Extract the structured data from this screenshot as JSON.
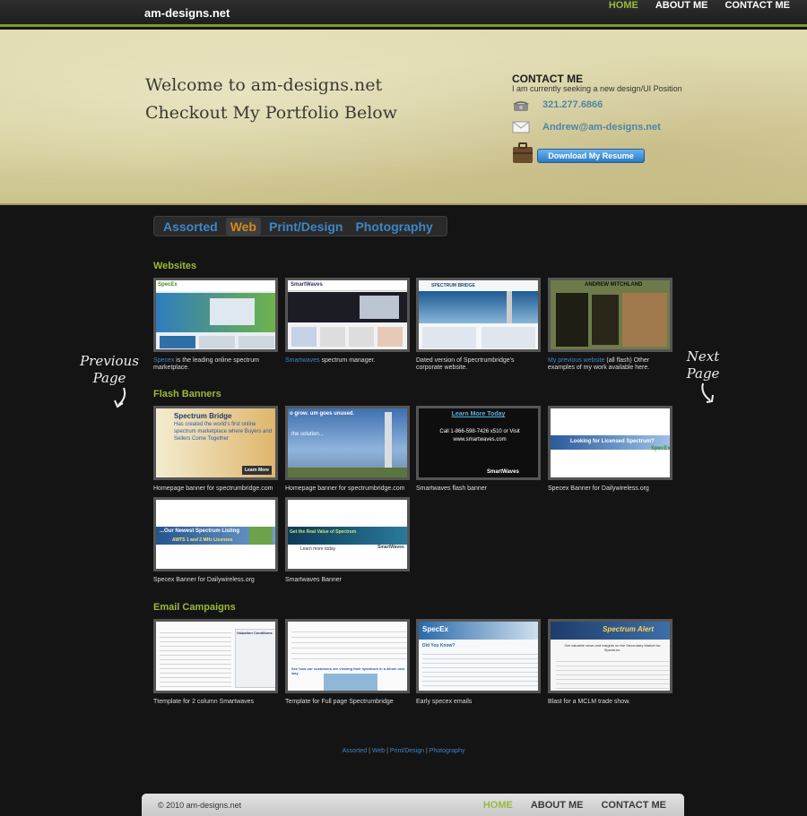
{
  "brand": {
    "logo": "am-designs.net"
  },
  "nav": {
    "items": [
      {
        "label": "HOME"
      },
      {
        "label": "ABOUT ME"
      },
      {
        "label": "CONTACT ME"
      }
    ]
  },
  "hero": {
    "line1": "Welcome to am-designs.net",
    "line2": "Checkout My Portfolio Below"
  },
  "contact": {
    "title": "CONTACT ME",
    "subtitle": "I am currently seeking a new design/UI Position",
    "phone": "321.277.6866",
    "email": "Andrew@am-designs.net",
    "resume_button": "Download My Resume"
  },
  "categories": {
    "items": [
      {
        "label": "Assorted"
      },
      {
        "label": "Web"
      },
      {
        "label": "Print/Design"
      },
      {
        "label": "Photography"
      }
    ]
  },
  "side": {
    "previous": "Previous Page",
    "next": "Next Page"
  },
  "sections": {
    "websites": {
      "title": "Websites",
      "items": [
        {
          "link": "Specex",
          "text": " is the leading online spectrum marketplace.",
          "shot": "SpecEx"
        },
        {
          "link": "Smartwaves",
          "text": " spectrum manager.",
          "shot": "SmartWaves"
        },
        {
          "link": "",
          "text": "Dated version of Specrtrumbridge's corporate website.",
          "shot": "SPECTRUM BRIDGE"
        },
        {
          "link": "My previous website",
          "text": " (all flash) Other examples of my work available here.",
          "shot": "ANDREW MITCHLAND"
        }
      ]
    },
    "flash": {
      "title": "Flash Banners",
      "items": [
        {
          "text": "Homepage banner for spectrumbridge.com",
          "shot": "Spectrum Bridge",
          "shot_sub": "Has created the world's first online spectrum marketplace where Buyers and Sellers Come Together",
          "shot_btn": "Learn More"
        },
        {
          "text": "Homepage banner for spectrumbridge.com",
          "shot": "o grow. um goes unused.",
          "shot_sub": "the solution..."
        },
        {
          "text": "Smartwaves flash banner",
          "shot": "Learn More Today",
          "shot_sub": "Call 1-866-598-7426 x510 or Visit www.smartwaves.com",
          "shot_btn": "SmartWaves"
        },
        {
          "text": "Specex Banner for Dailywireless.org",
          "shot": "Looking for Licensed Spectrum?",
          "shot_btn": "SpecEx"
        },
        {
          "text": "Specex Banner for Dailywireless.org",
          "shot": "...Our Newest Spectrum Listing",
          "shot_sub": "AWTS 1 and 2 MHz Licenses"
        },
        {
          "text": "Smartwaves Banner",
          "shot": "Get the Real Value of Spectrum",
          "shot_sub": "Learn more today",
          "shot_btn": "SmartWaves"
        }
      ]
    },
    "email": {
      "title": "Email Campaigns",
      "items": [
        {
          "text": "Ttemplate for 2 column Smartwaves",
          "shot": "Valuation Conditions"
        },
        {
          "text": "Template for Full page Spectrumbridge",
          "shot": "See how our customers are viewing their spectrum in a whole new way"
        },
        {
          "text": "Early specex emails",
          "shot": "SpecEx",
          "shot_sub": "Did You Know?"
        },
        {
          "text": "Blast for a MCLM trade show.",
          "shot": "Spectrum Alert",
          "shot_sub": "Get valuable news and insights on the Secondary Market for Spectrum."
        }
      ]
    }
  },
  "bottom_links": {
    "assorted": "Assorted",
    "web": "Web",
    "print": "Print/Design",
    "photo": "Photography",
    "sep": "|"
  },
  "footer": {
    "copyright": "© 2010 am-designs.net",
    "items": [
      {
        "label": "HOME"
      },
      {
        "label": "ABOUT ME"
      },
      {
        "label": "CONTACT ME"
      }
    ]
  },
  "colors": {
    "accent_green": "#9ab83c",
    "link_blue": "#3d86c6",
    "active_orange": "#d48a1c",
    "background": "#141414"
  }
}
